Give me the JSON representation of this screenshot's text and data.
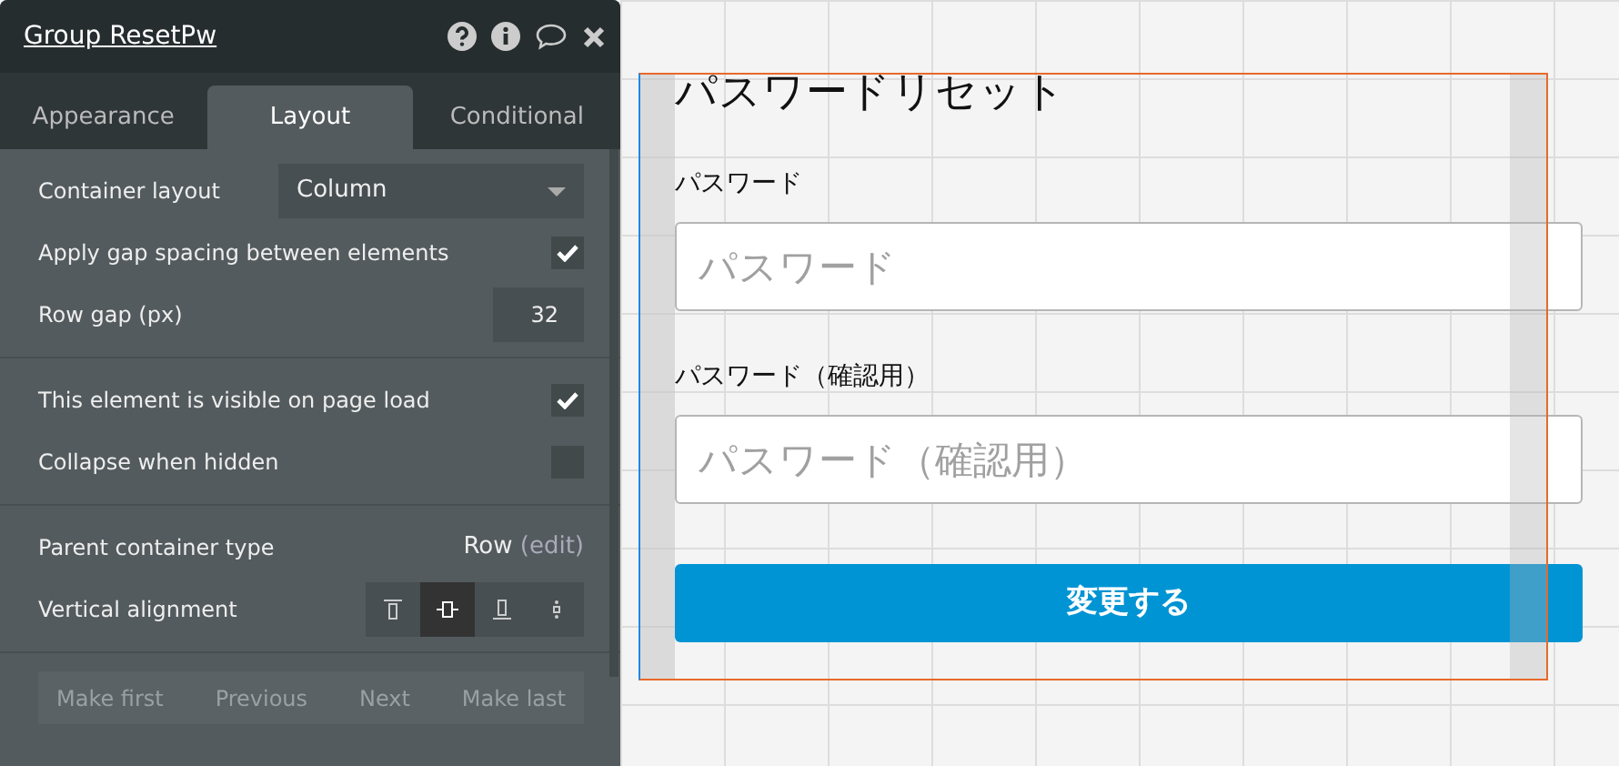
{
  "panel": {
    "title": "Group ResetPw",
    "tabs": [
      {
        "label": "Appearance",
        "selected": false
      },
      {
        "label": "Layout",
        "selected": true
      },
      {
        "label": "Conditional",
        "selected": false
      }
    ],
    "sections": [
      [
        {
          "kind": "dropdown",
          "label": "Container layout",
          "value": "Column"
        },
        {
          "kind": "checkbox",
          "label": "Apply gap spacing between elements",
          "checked": true
        },
        {
          "kind": "number",
          "label": "Row gap (px)",
          "value": "32"
        }
      ],
      [
        {
          "kind": "checkbox",
          "label": "This element is visible on page load",
          "checked": true
        },
        {
          "kind": "checkbox",
          "label": "Collapse when hidden",
          "checked": false
        }
      ],
      [
        {
          "kind": "info",
          "label": "Parent container type",
          "value": "Row",
          "link": "(edit)"
        },
        {
          "kind": "alignment",
          "label": "Vertical alignment",
          "options": [
            {
              "selected": false
            },
            {
              "selected": true
            },
            {
              "selected": false
            },
            {
              "selected": false
            }
          ]
        }
      ]
    ],
    "order_buttons": [
      {
        "label": "Make first",
        "disabled": true
      },
      {
        "label": "Previous",
        "disabled": true
      },
      {
        "label": "Next",
        "disabled": true
      },
      {
        "label": "Make last",
        "disabled": true
      }
    ]
  },
  "form": {
    "title": "パスワードリセット",
    "fields": [
      {
        "label": "パスワード",
        "placeholder": "パスワード"
      },
      {
        "label": "パスワード（確認用）",
        "placeholder": "パスワード（確認用）"
      }
    ],
    "button": "変更する"
  }
}
